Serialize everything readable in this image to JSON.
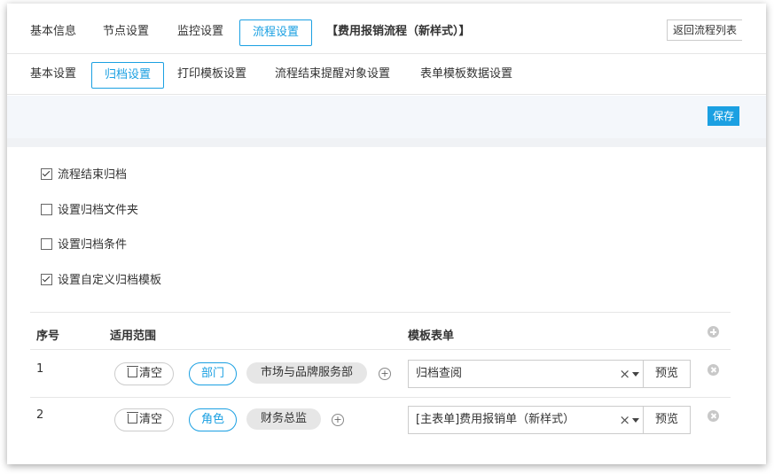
{
  "top_tabs": [
    {
      "label": "基本信息"
    },
    {
      "label": "节点设置"
    },
    {
      "label": "监控设置"
    },
    {
      "label": "流程设置",
      "active": true
    }
  ],
  "process_title": "【费用报销流程（新样式）】",
  "back_button": "返回流程列表",
  "sub_tabs": [
    {
      "label": "基本设置"
    },
    {
      "label": "归档设置",
      "active": true
    },
    {
      "label": "打印模板设置"
    },
    {
      "label": "流程结束提醒对象设置"
    },
    {
      "label": "表单模板数据设置"
    }
  ],
  "save_button": "保存",
  "options": [
    {
      "label": "流程结束归档",
      "checked": true
    },
    {
      "label": "设置归档文件夹",
      "checked": false
    },
    {
      "label": "设置归档条件",
      "checked": false
    },
    {
      "label": "设置自定义归档模板",
      "checked": true
    }
  ],
  "table": {
    "headers": {
      "index": "序号",
      "scope": "适用范围",
      "template": "模板表单"
    },
    "rows": [
      {
        "index": "1",
        "clear": "清空",
        "scope_type": "部门",
        "scope_value": "市场与品牌服务部",
        "template": "归档查阅",
        "preview": "预览"
      },
      {
        "index": "2",
        "clear": "清空",
        "scope_type": "角色",
        "scope_value": "财务总监",
        "template": "[主表单]费用报销单（新样式）",
        "preview": "预览"
      }
    ]
  },
  "colors": {
    "accent": "#1ba0e2"
  }
}
